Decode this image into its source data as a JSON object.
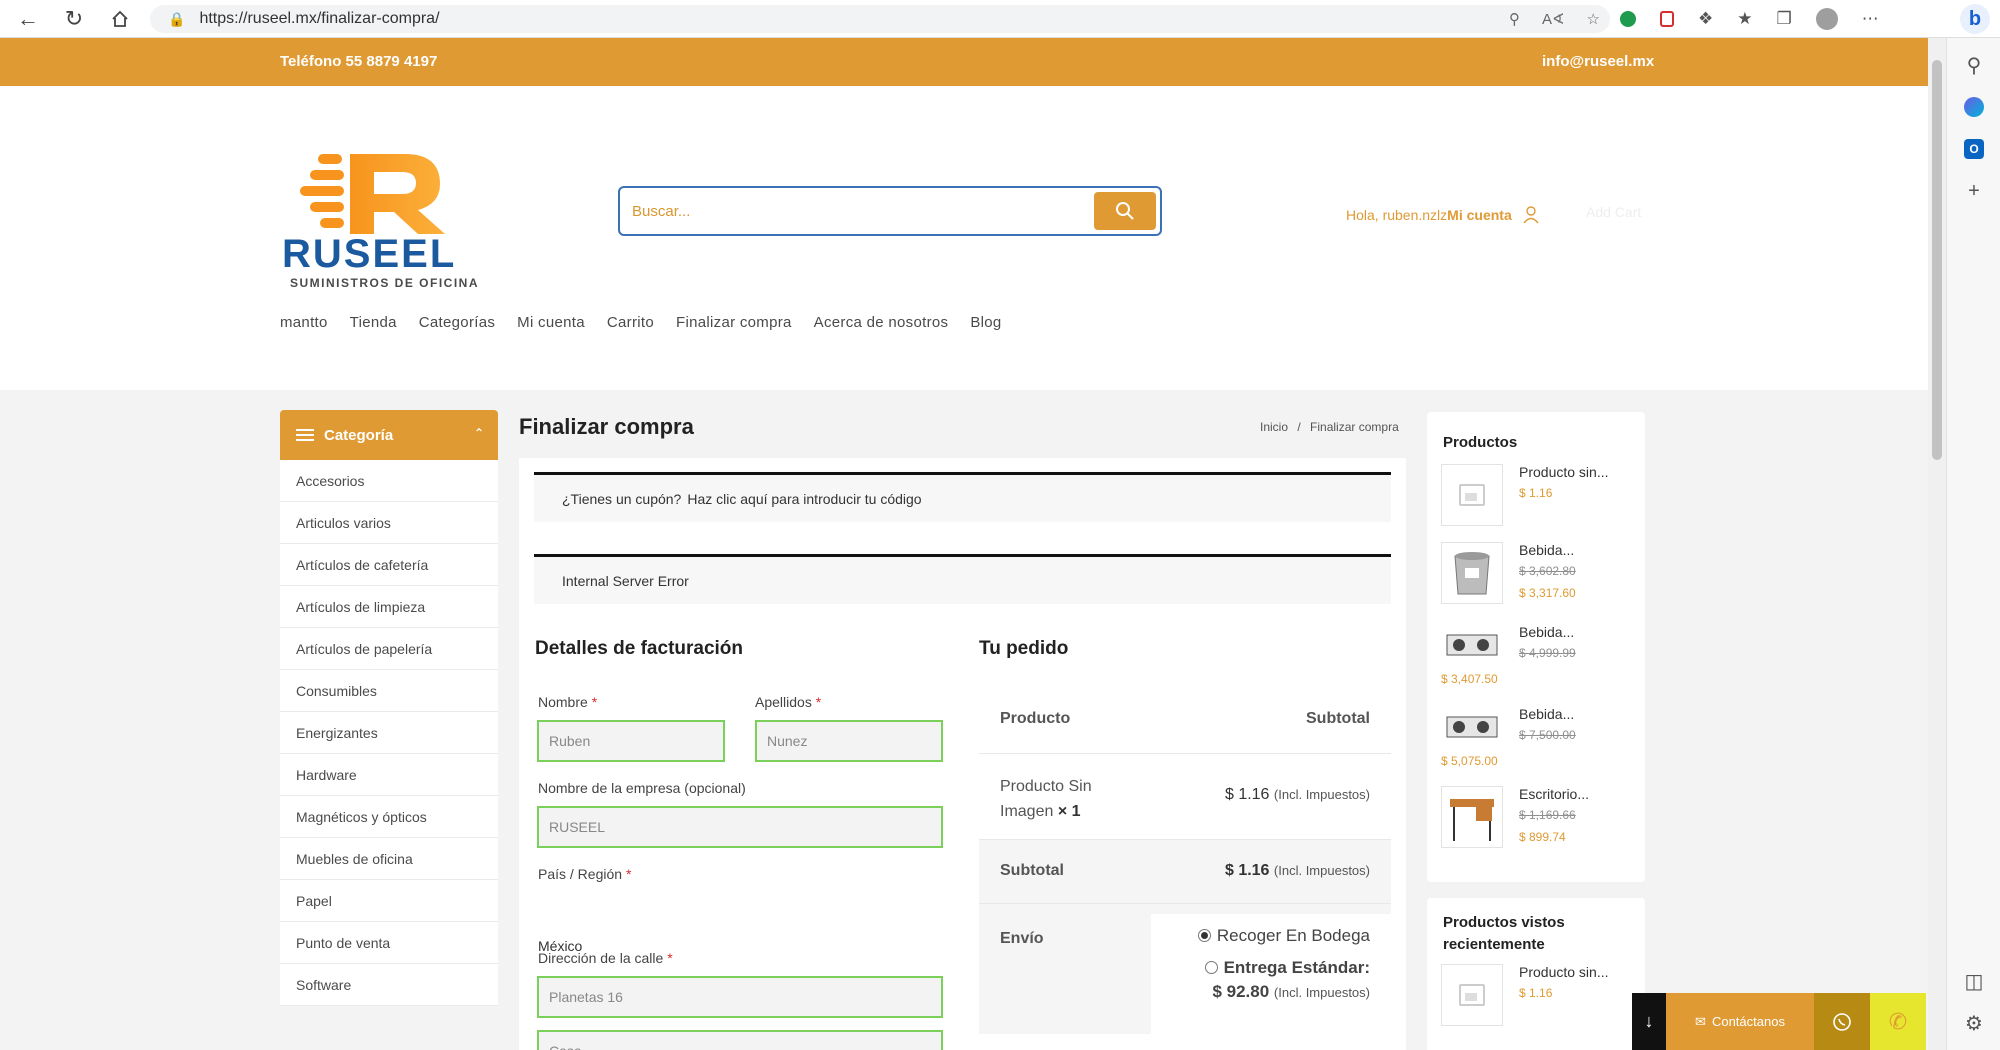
{
  "browser": {
    "url": "https://ruseel.mx/finalizar-compra/"
  },
  "topbar": {
    "phone": "Teléfono 55 8879 4197",
    "email": "info@ruseel.mx"
  },
  "logo": {
    "brand": "RUSEEL",
    "tagline": "SUMINISTROS DE OFICINA"
  },
  "search": {
    "placeholder": "Buscar..."
  },
  "account": {
    "greeting": "Hola, ruben.nzlz",
    "link": "Mi cuenta",
    "add_cart": "Add Cart"
  },
  "nav": [
    "mantto",
    "Tienda",
    "Categorías",
    "Mi cuenta",
    "Carrito",
    "Finalizar compra",
    "Acerca de nosotros",
    "Blog"
  ],
  "categories": {
    "title": "Categoría",
    "items": [
      "Accesorios",
      "Articulos varios",
      "Artículos de cafetería",
      "Artículos de limpieza",
      "Artículos de papelería",
      "Consumibles",
      "Energizantes",
      "Hardware",
      "Magnéticos y ópticos",
      "Muebles de oficina",
      "Papel",
      "Punto de venta",
      "Software"
    ]
  },
  "page": {
    "title": "Finalizar compra",
    "breadcrumb_home": "Inicio",
    "breadcrumb_sep": "/",
    "breadcrumb_current": "Finalizar compra"
  },
  "notices": {
    "coupon_question": "¿Tienes un cupón?",
    "coupon_link": "Haz clic aquí para introducir tu código",
    "error": "Internal Server Error"
  },
  "billing": {
    "title": "Detalles de facturación",
    "required_mark": "*",
    "first_name_label": "Nombre",
    "first_name_value": "Ruben",
    "last_name_label": "Apellidos",
    "last_name_value": "Nunez",
    "company_label": "Nombre de la empresa (opcional)",
    "company_value": "RUSEEL",
    "country_label": "País / Región",
    "country_value": "México",
    "street_label": "Dirección de la calle",
    "street_value": "Planetas 16",
    "street2_value": "Casa"
  },
  "order": {
    "title": "Tu pedido",
    "col_product": "Producto",
    "col_subtotal": "Subtotal",
    "item_name": "Producto Sin Imagen",
    "item_qty": "× 1",
    "item_price": "$ 1.16",
    "tax_note": "(Incl. Impuestos)",
    "subtotal_label": "Subtotal",
    "subtotal_value": "$ 1.16",
    "shipping_label": "Envío",
    "ship_opt1": "Recoger En Bodega",
    "ship_opt2": "Entrega Estándar:",
    "ship_opt2_price": "$ 92.80"
  },
  "widget_products": {
    "title": "Productos",
    "items": [
      {
        "name": "Producto sin...",
        "old": "",
        "price": "$ 1.16"
      },
      {
        "name": "Bebida...",
        "old": "$ 3,602.80",
        "price": "$ 3,317.60"
      },
      {
        "name": "Bebida...",
        "old": "$ 4,999.99",
        "price": "$ 3,407.50"
      },
      {
        "name": "Bebida...",
        "old": "$ 7,500.00",
        "price": "$ 5,075.00"
      },
      {
        "name": "Escritorio...",
        "old": "$ 1,169.66",
        "price": "$ 899.74"
      }
    ]
  },
  "widget_recent": {
    "title": "Productos vistos recientemente",
    "items": [
      {
        "name": "Producto sin...",
        "price": "$ 1.16"
      }
    ]
  },
  "contact_bar": {
    "label": "Contáctanos"
  },
  "colors": {
    "brand": "#e09a33",
    "logo_blue": "#1c5aa0",
    "field_border": "#7bcf5b"
  }
}
